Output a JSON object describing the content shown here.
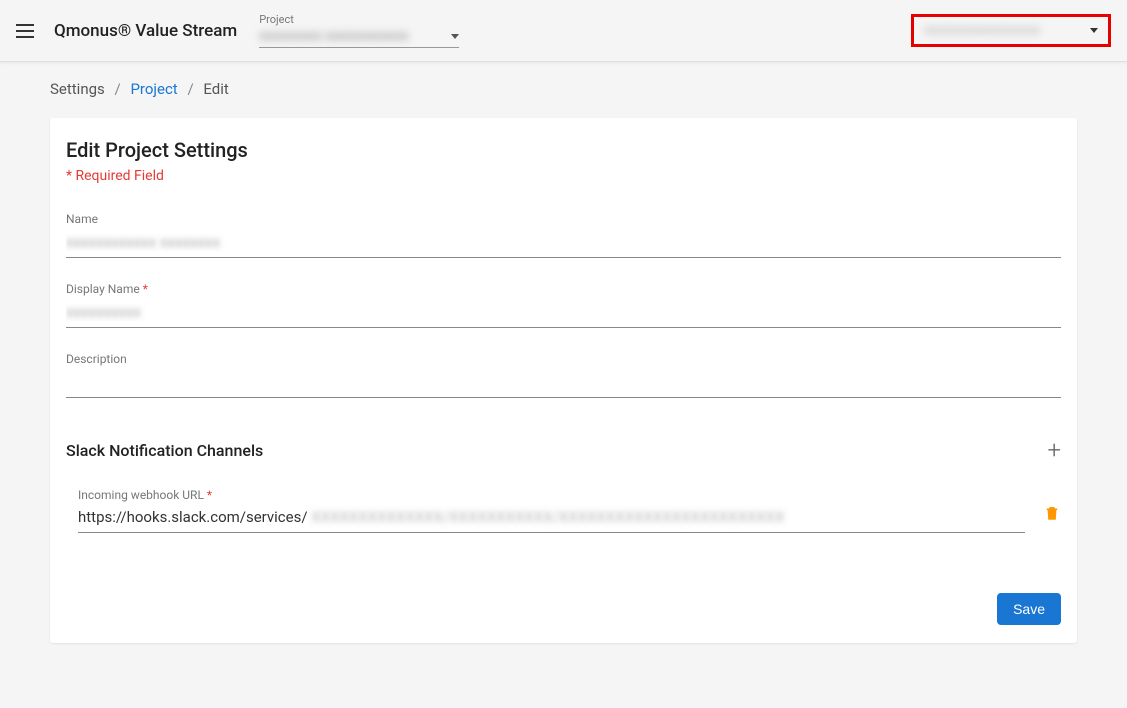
{
  "header": {
    "brand": "Qmonus® Value Stream",
    "project_label": "Project",
    "project_value": "xxxxxxxxx xxxxxxxxxxxx",
    "user_value": "xxxxxxxxxxxxxxxxxx"
  },
  "breadcrumb": {
    "item1": "Settings",
    "item2": "Project",
    "item3": "Edit"
  },
  "page": {
    "title": "Edit Project Settings",
    "required_note": "* Required Field"
  },
  "fields": {
    "name_label": "Name",
    "name_value": "xxxxxxxxxxxx xxxxxxxx",
    "display_name_label": "Display Name",
    "display_name_value": "xxxxxxxxxx",
    "description_label": "Description",
    "description_value": ""
  },
  "slack": {
    "section_title": "Slack Notification Channels",
    "webhook_label": "Incoming webhook URL",
    "webhook_value_visible": "https://hooks.slack.com/services/ ",
    "webhook_value_hidden": "XXXXXXXXXXXXXX/XXXXXXXXXXX/XXXXXXXXXXXXXXXXXXXXXXXX"
  },
  "actions": {
    "save": "Save"
  }
}
